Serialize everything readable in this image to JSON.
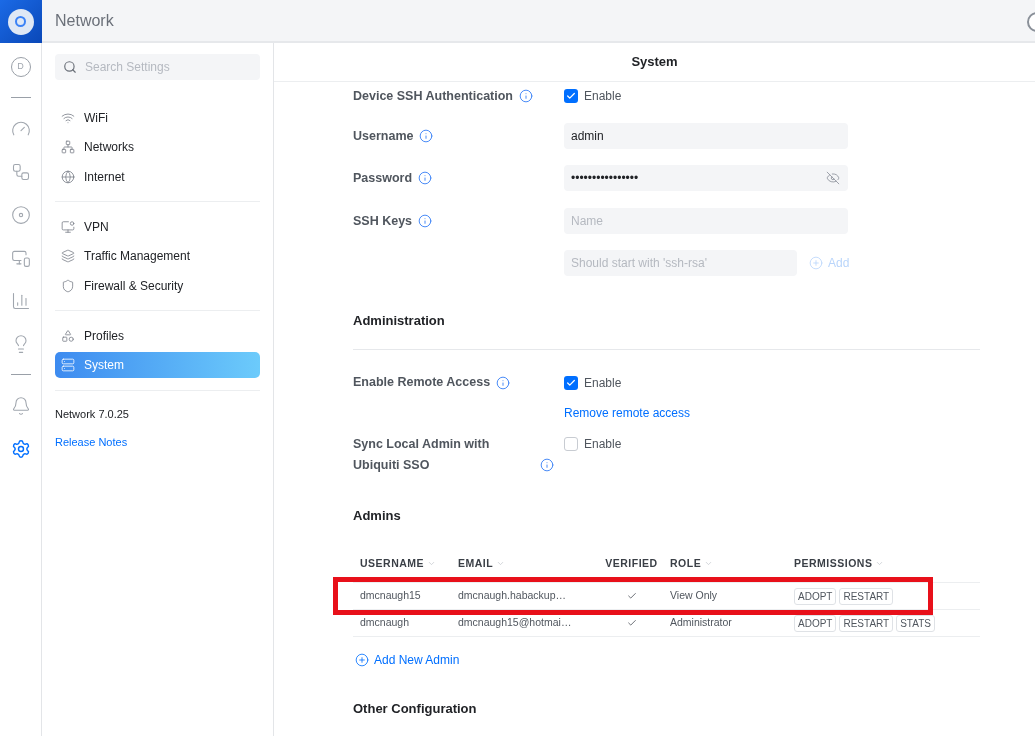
{
  "app": {
    "title": "Network"
  },
  "rail": {
    "items": [
      {
        "kind": "avatar",
        "label": "D",
        "selected": false
      },
      {
        "kind": "icon",
        "selected": false
      },
      {
        "kind": "icon",
        "selected": false
      },
      {
        "kind": "icon",
        "selected": false
      },
      {
        "kind": "icon",
        "selected": false
      },
      {
        "kind": "icon",
        "selected": false
      },
      {
        "kind": "icon",
        "selected": false
      },
      {
        "kind": "icon",
        "selected": false
      },
      {
        "kind": "icon",
        "selected": true
      }
    ]
  },
  "sidebar": {
    "search": {
      "placeholder": "Search Settings"
    },
    "groups": [
      [
        {
          "label": "WiFi",
          "selected": false
        },
        {
          "label": "Networks",
          "selected": false
        },
        {
          "label": "Internet",
          "selected": false
        }
      ],
      [
        {
          "label": "VPN",
          "selected": false
        },
        {
          "label": "Traffic Management",
          "selected": false
        },
        {
          "label": "Firewall & Security",
          "selected": false
        }
      ],
      [
        {
          "label": "Profiles",
          "selected": false
        },
        {
          "label": "System",
          "selected": true
        }
      ]
    ],
    "version": "Network 7.0.25",
    "release_notes": "Release Notes"
  },
  "main": {
    "title": "System",
    "ssh": {
      "auth": {
        "label": "Device SSH Authentication",
        "checked": true,
        "option": "Enable"
      },
      "username": {
        "label": "Username",
        "value": "admin"
      },
      "password": {
        "label": "Password",
        "value": "••••••••••••••••"
      },
      "keys": {
        "label": "SSH Keys",
        "name_placeholder": "Name",
        "key_placeholder": "Should start with 'ssh-rsa'",
        "add": "Add",
        "add_disabled": true
      }
    },
    "administration": {
      "title": "Administration",
      "remote_access": {
        "label": "Enable Remote Access",
        "checked": true,
        "option": "Enable",
        "link": "Remove remote access"
      },
      "sync_sso": {
        "label": "Sync Local Admin with Ubiquiti SSO",
        "checked": false,
        "option": "Enable"
      }
    },
    "admins": {
      "title": "Admins",
      "columns": [
        {
          "label": "USERNAME",
          "sortable": true
        },
        {
          "label": "EMAIL",
          "sortable": true
        },
        {
          "label": "VERIFIED",
          "sortable": false
        },
        {
          "label": "ROLE",
          "sortable": true
        },
        {
          "label": "PERMISSIONS",
          "sortable": true
        }
      ],
      "rows": [
        {
          "username": "dmcnaugh15",
          "email": "dmcnaugh.habackup…",
          "verified": true,
          "role": "View Only",
          "permissions": [
            "ADOPT",
            "RESTART"
          ],
          "highlighted": true
        },
        {
          "username": "dmcnaugh",
          "email": "dmcnaugh15@hotmai…",
          "verified": true,
          "role": "Administrator",
          "permissions": [
            "ADOPT",
            "RESTART",
            "STATS"
          ],
          "highlighted": false
        }
      ],
      "add": "Add New Admin"
    },
    "other": {
      "title": "Other Configuration"
    }
  }
}
